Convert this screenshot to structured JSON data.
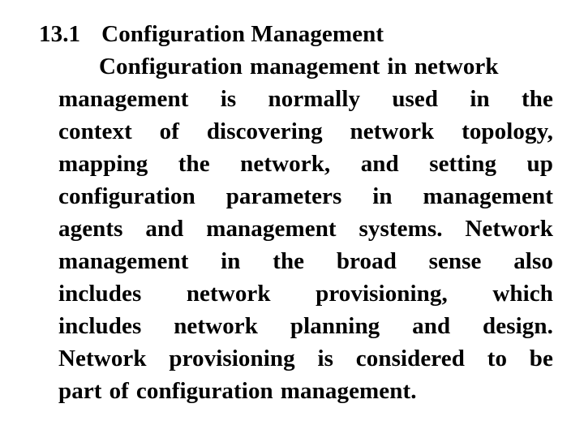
{
  "page": {
    "background_color": "#ffffff",
    "text_color": "#000000"
  },
  "heading": {
    "number": "13.1",
    "title": "Configuration Management"
  },
  "paragraph": {
    "full_text": "Configuration management in network management is normally used in the context of discovering network topology, mapping the network, and setting up configuration parameters in management agents and management systems. Network management in the broad sense also includes network provisioning, which includes network planning and design. Network provisioning is considered to be part of configuration management.",
    "lines": [
      {
        "align": "indent",
        "words": [
          "Configuration",
          "management",
          "in",
          "network"
        ]
      },
      {
        "align": "justify",
        "words": [
          "management",
          "is",
          "normally",
          "used",
          "in",
          "the"
        ]
      },
      {
        "align": "justify",
        "words": [
          "context",
          "of",
          "discovering",
          "network",
          "topology,"
        ]
      },
      {
        "align": "justify",
        "words": [
          "mapping",
          "the",
          "network,",
          "and",
          "setting",
          "up"
        ]
      },
      {
        "align": "justify",
        "words": [
          "configuration",
          "parameters",
          "in",
          "management"
        ]
      },
      {
        "align": "justify",
        "words": [
          "agents",
          "and",
          "management",
          "systems.",
          "Network"
        ]
      },
      {
        "align": "justify",
        "words": [
          "management",
          "in",
          "the",
          "broad",
          "sense",
          "also"
        ]
      },
      {
        "align": "justify",
        "words": [
          "includes",
          "network",
          "provisioning,",
          "which"
        ]
      },
      {
        "align": "justify",
        "words": [
          "includes",
          "network",
          "planning",
          "and",
          "design."
        ]
      },
      {
        "align": "justify",
        "words": [
          "Network",
          "provisioning",
          "is",
          "considered",
          "to",
          "be"
        ]
      },
      {
        "align": "flush",
        "words": [
          "part",
          "of",
          "configuration",
          "management."
        ]
      }
    ]
  }
}
